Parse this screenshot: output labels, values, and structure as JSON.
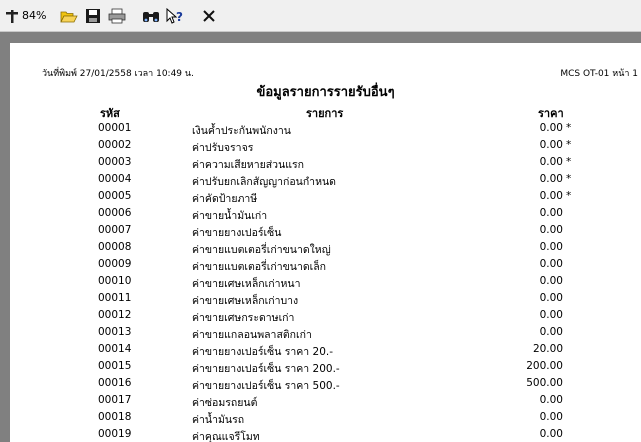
{
  "toolbar": {
    "zoom": "84%",
    "buttons": [
      "zoom-icon",
      "open-icon",
      "save-icon",
      "print-icon",
      "find-icon",
      "help-icon",
      "close-icon"
    ]
  },
  "report": {
    "print_date": "วันที่พิมพ์ 27/01/2558  เวลา 10:49 น.",
    "code_page": "MCS OT-01 หน้า 1",
    "title": "ข้อมูลรายการรายรับอื่นๆ",
    "headers": {
      "code": "รหัส",
      "item": "รายการ",
      "amount": "ราคา"
    },
    "rows": [
      {
        "code": "00001",
        "desc": "เงินค้ำประกันพนักงาน",
        "amount": "0.00",
        "mark": "*"
      },
      {
        "code": "00002",
        "desc": "ค่าปรับจราจร",
        "amount": "0.00",
        "mark": "*"
      },
      {
        "code": "00003",
        "desc": "ค่าความเสียหายส่วนแรก",
        "amount": "0.00",
        "mark": "*"
      },
      {
        "code": "00004",
        "desc": "ค่าปรับยกเลิกสัญญาก่อนกำหนด",
        "amount": "0.00",
        "mark": "*"
      },
      {
        "code": "00005",
        "desc": "ค่าคัดป้ายภาษี",
        "amount": "0.00",
        "mark": "*"
      },
      {
        "code": "00006",
        "desc": "ค่าขายน้ำมันเก่า",
        "amount": "0.00",
        "mark": ""
      },
      {
        "code": "00007",
        "desc": "ค่าขายยางเปอร์เซ็น",
        "amount": "0.00",
        "mark": ""
      },
      {
        "code": "00008",
        "desc": "ค่าขายแบตเตอรี่เก่าขนาดใหญ่",
        "amount": "0.00",
        "mark": ""
      },
      {
        "code": "00009",
        "desc": "ค่าขายแบตเตอรี่เก่าขนาดเล็ก",
        "amount": "0.00",
        "mark": ""
      },
      {
        "code": "00010",
        "desc": "ค่าขายเศษเหล็กเก่าหนา",
        "amount": "0.00",
        "mark": ""
      },
      {
        "code": "00011",
        "desc": "ค่าขายเศษเหล็กเก่าบาง",
        "amount": "0.00",
        "mark": ""
      },
      {
        "code": "00012",
        "desc": "ค่าขายเศษกระดาษเก่า",
        "amount": "0.00",
        "mark": ""
      },
      {
        "code": "00013",
        "desc": "ค่าขายแกลอนพลาสติกเก่า",
        "amount": "0.00",
        "mark": ""
      },
      {
        "code": "00014",
        "desc": "ค่าขายยางเปอร์เซ็น ราคา 20.-",
        "amount": "20.00",
        "mark": ""
      },
      {
        "code": "00015",
        "desc": "ค่าขายยางเปอร์เซ็น ราคา 200.-",
        "amount": "200.00",
        "mark": ""
      },
      {
        "code": "00016",
        "desc": "ค่าขายยางเปอร์เซ็น ราคา 500.-",
        "amount": "500.00",
        "mark": ""
      },
      {
        "code": "00017",
        "desc": "ค่าซ่อมรถยนต์",
        "amount": "0.00",
        "mark": ""
      },
      {
        "code": "00018",
        "desc": "ค่าน้ำมันรถ",
        "amount": "0.00",
        "mark": ""
      },
      {
        "code": "00019",
        "desc": "ค่าคุณแจรีโมท",
        "amount": "0.00",
        "mark": ""
      }
    ]
  }
}
